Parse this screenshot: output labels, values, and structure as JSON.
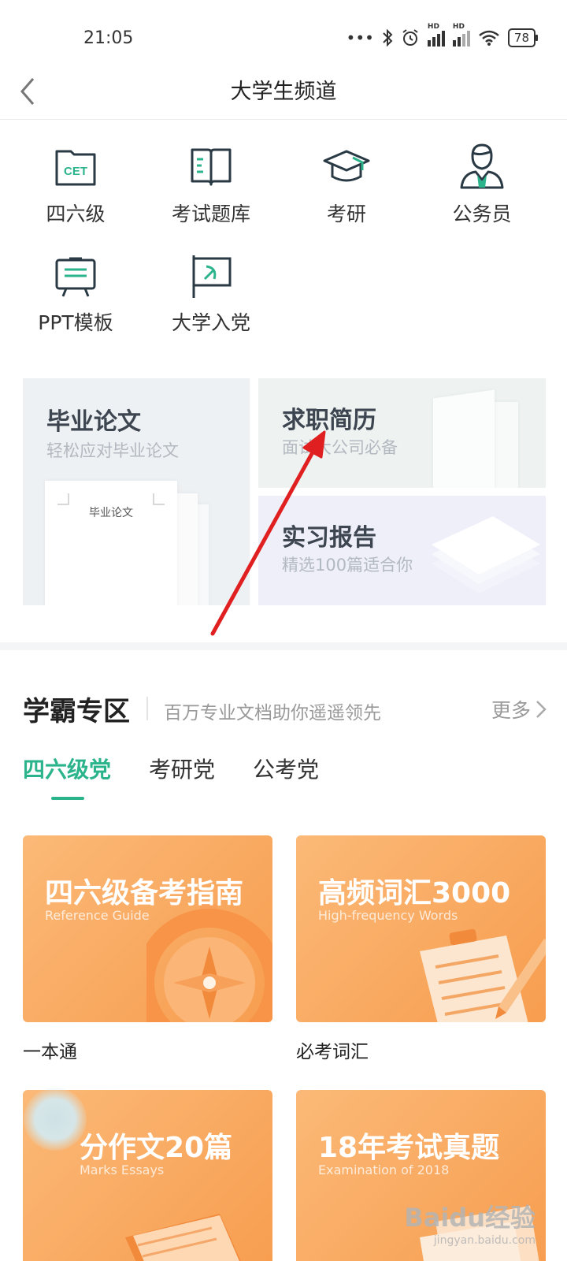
{
  "status_bar": {
    "time": "21:05",
    "dots": "•••",
    "bluetooth_icon": "bluetooth-icon",
    "alarm_icon": "alarm-icon",
    "signal_label": "HD",
    "wifi_icon": "wifi-icon",
    "battery": "78"
  },
  "header": {
    "title": "大学生频道",
    "back_icon": "chevron-left-icon"
  },
  "categories": [
    {
      "label": "四六级",
      "icon": "cet-folder-icon",
      "icon_text": "CET"
    },
    {
      "label": "考试题库",
      "icon": "book-icon"
    },
    {
      "label": "考研",
      "icon": "graduation-cap-icon"
    },
    {
      "label": "公务员",
      "icon": "civil-servant-person-icon"
    },
    {
      "label": "PPT模板",
      "icon": "presentation-board-icon"
    },
    {
      "label": "大学入党",
      "icon": "party-flag-icon"
    }
  ],
  "features": {
    "thesis": {
      "title": "毕业论文",
      "subtitle": "轻松应对毕业论文",
      "paper_label": "毕业论文"
    },
    "resume": {
      "title": "求职简历",
      "subtitle": "面试大公司必备"
    },
    "report": {
      "title": "实习报告",
      "subtitle": "精选100篇适合你"
    }
  },
  "section": {
    "title": "学霸专区",
    "subtitle": "百万专业文档助你遥遥领先",
    "more": "更多"
  },
  "tabs": [
    {
      "label": "四六级党",
      "active": true
    },
    {
      "label": "考研党",
      "active": false
    },
    {
      "label": "公考党",
      "active": false
    }
  ],
  "products": [
    {
      "title": "四六级备考指南",
      "subtitle_en": "Reference Guide",
      "name": "一本通",
      "icon": "compass-icon"
    },
    {
      "title": "高频词汇3000",
      "subtitle_en": "High-frequency Words",
      "name": "必考词汇",
      "icon": "clipboard-pencil-icon"
    },
    {
      "title": "分作文20篇",
      "subtitle_en": "Marks Essays",
      "icon": "book-icon"
    },
    {
      "title": "18年考试真题",
      "subtitle_en": "Examination of 2018",
      "icon": "papers-icon"
    }
  ],
  "watermark": {
    "main": "Baidu经验",
    "sub": "jingyan.baidu.com"
  },
  "colors": {
    "accent": "#2bb48c",
    "card_orange": "#f8a55b",
    "title_gray": "#3d4550"
  }
}
